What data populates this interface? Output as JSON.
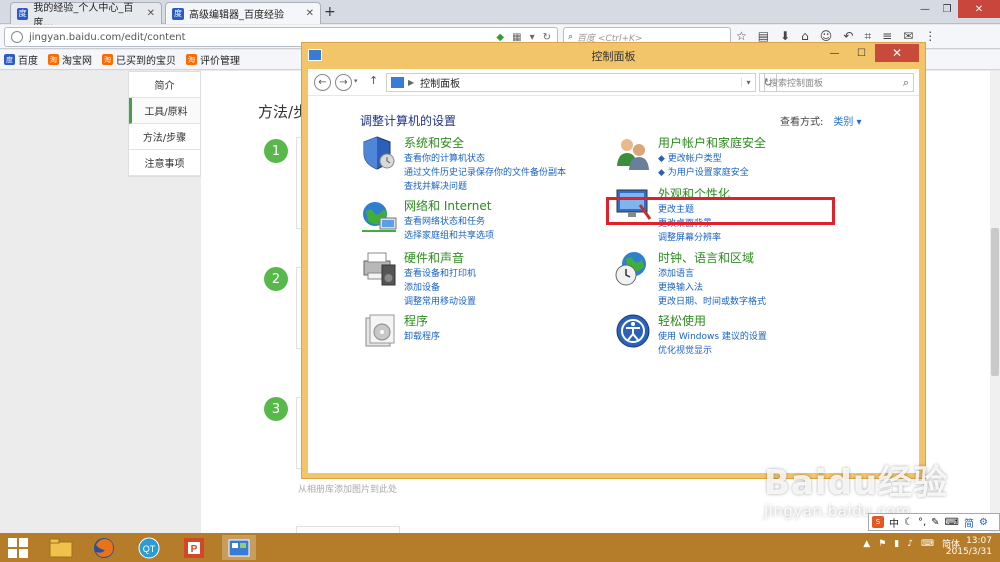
{
  "browser": {
    "tabs": [
      {
        "label": "我的经验_个人中心_百度..."
      },
      {
        "label": "高级编辑器_百度经验"
      }
    ],
    "url": "jingyan.baidu.com/edit/content",
    "search_placeholder": "百度 <Ctrl+K>",
    "bookmarks": [
      {
        "label": "百度",
        "icon": "baidu-icon"
      },
      {
        "label": "淘宝网",
        "icon": "taobao-icon"
      },
      {
        "label": "已买到的宝贝",
        "icon": "taobao-icon"
      },
      {
        "label": "评价管理",
        "icon": "taobao-icon"
      }
    ]
  },
  "page": {
    "leftnav": [
      "简介",
      "工具/原料",
      "方法/步骤",
      "注意事项"
    ],
    "section_title": "方法/步",
    "steps": [
      "1",
      "2",
      "3"
    ],
    "photo_hint": "从相册库添加图片到此处"
  },
  "control_panel": {
    "title": "控制面板",
    "address": "控制面板",
    "search_placeholder": "搜索控制面板",
    "heading": "调整计算机的设置",
    "view_by_label": "查看方式:",
    "view_by_value": "类别 ▾",
    "categories": [
      {
        "title": "系统和安全",
        "links": [
          "查看你的计算机状态",
          "通过文件历史记录保存你的文件备份副本",
          "查找并解决问题"
        ]
      },
      {
        "title": "网络和 Internet",
        "links": [
          "查看网络状态和任务",
          "选择家庭组和共享选项"
        ]
      },
      {
        "title": "硬件和声音",
        "links": [
          "查看设备和打印机",
          "添加设备",
          "调整常用移动设置"
        ]
      },
      {
        "title": "程序",
        "links": [
          "卸载程序"
        ]
      },
      {
        "title": "用户帐户和家庭安全",
        "links": [
          "更改帐户类型",
          "为用户设置家庭安全"
        ]
      },
      {
        "title": "外观和个性化",
        "links": [
          "更改主题",
          "更改桌面背景",
          "调整屏幕分辨率"
        ]
      },
      {
        "title": "时钟、语言和区域",
        "links": [
          "添加语言",
          "更换输入法",
          "更改日期、时间或数字格式"
        ]
      },
      {
        "title": "轻松使用",
        "links": [
          "使用 Windows 建议的设置",
          "优化视觉显示"
        ]
      }
    ]
  },
  "taskbar": {
    "ime_indicator": "简体",
    "time": "13:07",
    "date": "2015/3/31"
  },
  "ime_bar": {
    "mode": "中",
    "charset": "简"
  },
  "watermark": {
    "brand": "Baidu经验",
    "domain": "jingyan.baidu.com"
  },
  "colors": {
    "accent_green": "#58b94a",
    "link_blue": "#1a63c2",
    "highlight_red": "#e0202a",
    "taskbar": "#b57d29"
  }
}
